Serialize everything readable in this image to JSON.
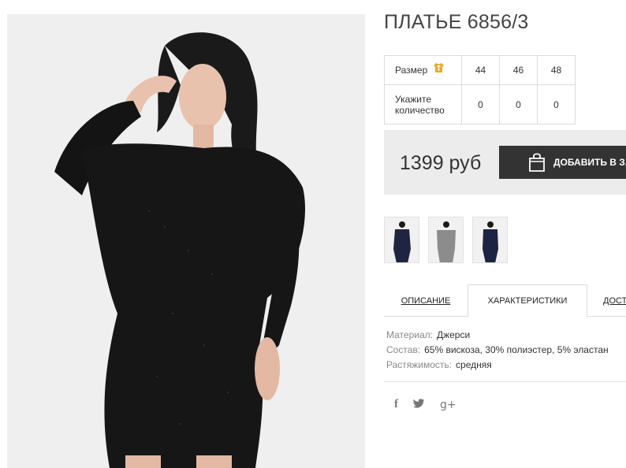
{
  "product": {
    "title": "ПЛАТЬЕ 6856/3"
  },
  "sizes": {
    "size_label": "Размер",
    "qty_label": "Укажите количество",
    "columns": [
      "44",
      "46",
      "48"
    ],
    "quantities": [
      "0",
      "0",
      "0"
    ]
  },
  "purchase": {
    "price": "1399 руб",
    "cart_button_label": "ДОБАВИТЬ В ЗАКАЗ"
  },
  "tabs": [
    {
      "label": "ОПИСАНИЕ"
    },
    {
      "label": "ХАРАКТЕРИСТИКИ"
    },
    {
      "label": "ДОСТАВКА"
    }
  ],
  "specs": [
    {
      "key": "Материал:",
      "value": "Джерси"
    },
    {
      "key": "Состав:",
      "value": "65% вискоза, 30% полиэстер, 5% эластан"
    },
    {
      "key": "Растяжимость:",
      "value": "средняя"
    }
  ],
  "social": {
    "facebook": "f",
    "google": "g+"
  },
  "icons": {
    "size_guide": "size-guide-icon",
    "bag": "shopping-bag-icon",
    "facebook": "facebook-icon",
    "twitter": "twitter-icon",
    "google_plus": "google-plus-icon"
  },
  "colors": {
    "button_bg": "#333333",
    "price_box_bg": "#ececec",
    "size_icon": "#f2a81d"
  }
}
